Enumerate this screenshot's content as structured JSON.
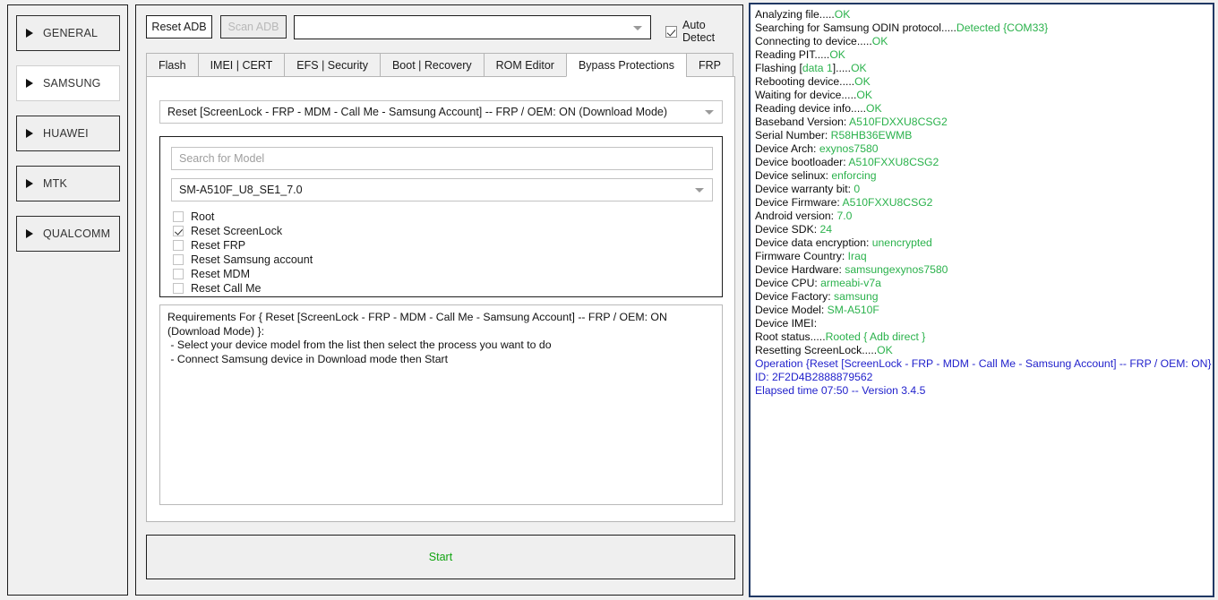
{
  "sidebar": {
    "items": [
      {
        "label": "GENERAL",
        "selected": false
      },
      {
        "label": "SAMSUNG",
        "selected": true
      },
      {
        "label": "HUAWEI",
        "selected": false
      },
      {
        "label": "MTK",
        "selected": false
      },
      {
        "label": "QUALCOMM",
        "selected": false
      }
    ]
  },
  "toolbar": {
    "reset_adb_label": "Reset ADB",
    "scan_adb_label": "Scan ADB",
    "device_combo_value": "",
    "auto_detect_label": "Auto Detect",
    "auto_detect_checked": true
  },
  "tabs": [
    {
      "label": "Flash",
      "active": false
    },
    {
      "label": "IMEI | CERT",
      "active": false
    },
    {
      "label": "EFS | Security",
      "active": false
    },
    {
      "label": "Boot | Recovery",
      "active": false
    },
    {
      "label": "ROM Editor",
      "active": false
    },
    {
      "label": "Bypass Protections",
      "active": true
    },
    {
      "label": "FRP",
      "active": false
    }
  ],
  "panel": {
    "process_combo_value": "Reset [ScreenLock - FRP - MDM - Call Me - Samsung Account] -- FRP / OEM: ON (Download Mode)",
    "search_placeholder": "Search for Model",
    "model_combo_value": "SM-A510F_U8_SE1_7.0",
    "options": [
      {
        "label": "Root",
        "checked": false
      },
      {
        "label": "Reset ScreenLock",
        "checked": true
      },
      {
        "label": "Reset FRP",
        "checked": false
      },
      {
        "label": "Reset Samsung account",
        "checked": false
      },
      {
        "label": "Reset MDM",
        "checked": false
      },
      {
        "label": "Reset Call Me",
        "checked": false
      }
    ],
    "requirements_text": "Requirements For { Reset [ScreenLock - FRP - MDM - Call Me - Samsung Account] -- FRP / OEM: ON (Download Mode) }:\n - Select your device model from the list then select the process you want to do\n - Connect Samsung device in Download mode then Start",
    "start_label": "Start"
  },
  "log": {
    "lines": [
      {
        "label": "Analyzing file.....",
        "value": "OK",
        "color": "green"
      },
      {
        "label": "Searching for Samsung ODIN protocol.....",
        "value": "Detected {COM33}",
        "color": "green"
      },
      {
        "label": "Connecting to device.....",
        "value": "OK",
        "color": "green"
      },
      {
        "label": "Reading PIT.....",
        "value": "OK",
        "color": "green"
      },
      {
        "label": "Flashing [",
        "value": "data 1",
        "suffix_label": "].....",
        "suffix_value": "OK",
        "color": "green"
      },
      {
        "label": "Rebooting device.....",
        "value": "OK",
        "color": "green"
      },
      {
        "label": "Waiting for device.....",
        "value": "OK",
        "color": "green"
      },
      {
        "label": "Reading device info.....",
        "value": "OK",
        "color": "green"
      },
      {
        "label": "Baseband Version: ",
        "value": "A510FDXXU8CSG2",
        "color": "green"
      },
      {
        "label": "Serial Number: ",
        "value": "R58HB36EWMB",
        "color": "green"
      },
      {
        "label": "Device Arch: ",
        "value": "exynos7580",
        "color": "green"
      },
      {
        "label": "Device bootloader: ",
        "value": "A510FXXU8CSG2",
        "color": "green"
      },
      {
        "label": "Device selinux: ",
        "value": "enforcing",
        "color": "green"
      },
      {
        "label": "Device warranty bit: ",
        "value": "0",
        "color": "green"
      },
      {
        "label": "Device Firmware: ",
        "value": "A510FXXU8CSG2",
        "color": "green"
      },
      {
        "label": "Android version: ",
        "value": "7.0",
        "color": "green"
      },
      {
        "label": "Device SDK: ",
        "value": "24",
        "color": "green"
      },
      {
        "label": "Device data encryption: ",
        "value": "unencrypted",
        "color": "green"
      },
      {
        "label": "Firmware Country: ",
        "value": "Iraq",
        "color": "green"
      },
      {
        "label": "Device Hardware: ",
        "value": "samsungexynos7580",
        "color": "green"
      },
      {
        "label": "Device CPU: ",
        "value": "armeabi-v7a",
        "color": "green"
      },
      {
        "label": "Device Factory: ",
        "value": "samsung",
        "color": "green"
      },
      {
        "label": "Device Model: ",
        "value": "SM-A510F",
        "color": "green"
      },
      {
        "label": "Device IMEI:",
        "value": "",
        "color": "green"
      },
      {
        "label": "Root status.....",
        "value": "Rooted { Adb direct }",
        "color": "green"
      },
      {
        "label": "Resetting ScreenLock.....",
        "value": "OK",
        "color": "green"
      },
      {
        "label": "Operation {Reset [ScreenLock - FRP - MDM - Call Me - Samsung Account] -- FRP / OEM: ON}",
        "value": "",
        "color": "blue"
      },
      {
        "label": "ID: 2F2D4B2888879562",
        "value": "",
        "color": "blue"
      },
      {
        "label": "Elapsed time 07:50 -- Version 3.4.5",
        "value": "",
        "color": "blue"
      }
    ]
  },
  "colors": {
    "green": "#2bb24c",
    "blue": "#2222cc",
    "log_border": "#203864",
    "window_bg": "#f0f0f0"
  }
}
